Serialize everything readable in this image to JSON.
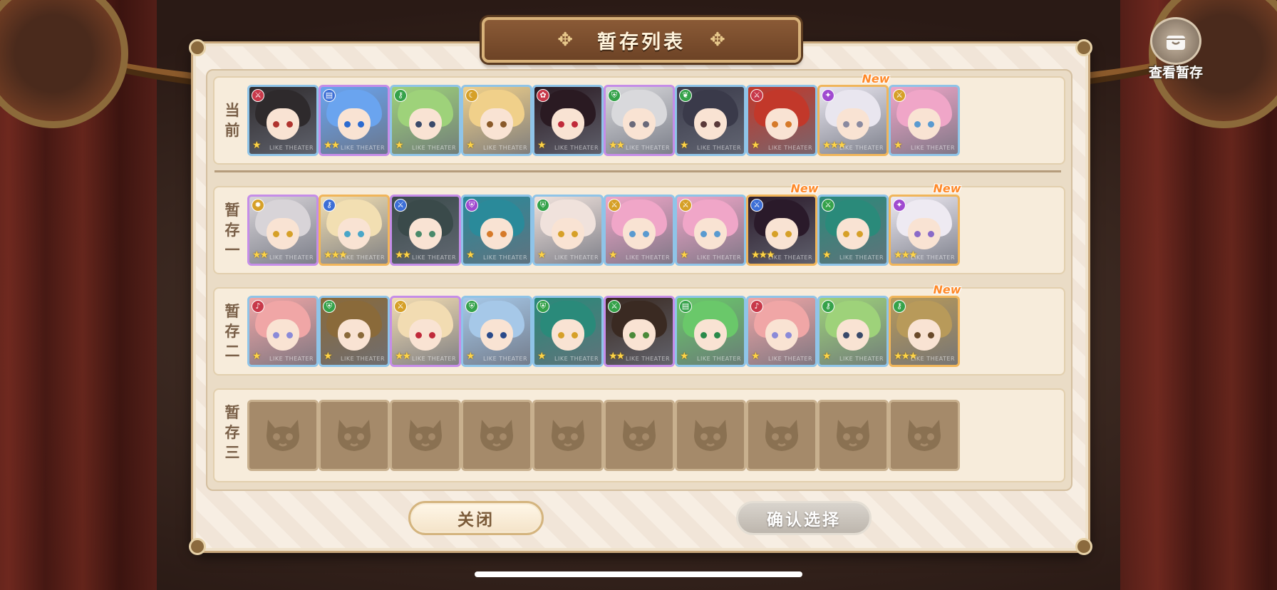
{
  "title": "暂存列表",
  "view_stash_label": "查看暂存",
  "rows": [
    {
      "label": [
        "当",
        "前"
      ],
      "cards": [
        {
          "rarity": 1,
          "element": "sword",
          "elem_color": "#c8394a",
          "hair": "#2e2a2c",
          "eyes": "#b0342f",
          "new": false
        },
        {
          "rarity": 2,
          "element": "book",
          "elem_color": "#3d6fd6",
          "hair": "#6aa4ef",
          "eyes": "#2c6bd0",
          "new": false
        },
        {
          "rarity": 1,
          "element": "key",
          "elem_color": "#35a24a",
          "hair": "#9ed27a",
          "eyes": "#3a4a6a",
          "new": false
        },
        {
          "rarity": 1,
          "element": "moon",
          "elem_color": "#d6a028",
          "hair": "#f0d08a",
          "eyes": "#8a5a2a",
          "new": false
        },
        {
          "rarity": 1,
          "element": "rose",
          "elem_color": "#c8394a",
          "hair": "#2a1a22",
          "eyes": "#c02a3a",
          "new": false
        },
        {
          "rarity": 2,
          "element": "shield",
          "elem_color": "#35a24a",
          "hair": "#d9d9dc",
          "eyes": "#6a6a7a",
          "new": false
        },
        {
          "rarity": 1,
          "element": "leaf",
          "elem_color": "#35a24a",
          "hair": "#3a3a4a",
          "eyes": "#5a3a3a",
          "new": false
        },
        {
          "rarity": 1,
          "element": "sword",
          "elem_color": "#c8394a",
          "hair": "#c2382a",
          "eyes": "#d67a2a",
          "new": false
        },
        {
          "rarity": 3,
          "element": "wand",
          "elem_color": "#a04ad0",
          "hair": "#e9e6ef",
          "eyes": "#8a8aa0",
          "new": true
        },
        {
          "rarity": 1,
          "element": "sword",
          "elem_color": "#d6a028",
          "hair": "#f0a6c8",
          "eyes": "#5a9ad0",
          "new": false
        }
      ]
    },
    {
      "label": [
        "暂",
        "存",
        "一"
      ],
      "cards": [
        {
          "rarity": 2,
          "element": "gear",
          "elem_color": "#d6a028",
          "hair": "#d8d4d8",
          "eyes": "#d6a028",
          "new": false
        },
        {
          "rarity": 3,
          "element": "key",
          "elem_color": "#3d6fd6",
          "hair": "#f2dfb2",
          "eyes": "#4aa6c8",
          "new": false
        },
        {
          "rarity": 2,
          "element": "sword",
          "elem_color": "#3d6fd6",
          "hair": "#3a4a4a",
          "eyes": "#4a8a6a",
          "new": false
        },
        {
          "rarity": 1,
          "element": "shield",
          "elem_color": "#a04ad0",
          "hair": "#2a8a9a",
          "eyes": "#d67a2a",
          "new": false
        },
        {
          "rarity": 1,
          "element": "shield",
          "elem_color": "#35a24a",
          "hair": "#f0e2dc",
          "eyes": "#d6a028",
          "new": false
        },
        {
          "rarity": 1,
          "element": "sword",
          "elem_color": "#d6a028",
          "hair": "#f0a6c8",
          "eyes": "#5a9ad0",
          "new": false
        },
        {
          "rarity": 1,
          "element": "sword",
          "elem_color": "#d6a028",
          "hair": "#f0a6c8",
          "eyes": "#5a9ad0",
          "new": false
        },
        {
          "rarity": 3,
          "element": "sword",
          "elem_color": "#3d6fd6",
          "hair": "#2a1a2a",
          "eyes": "#d6a028",
          "new": true
        },
        {
          "rarity": 1,
          "element": "sword",
          "elem_color": "#35a24a",
          "hair": "#2a8a7a",
          "eyes": "#d6a028",
          "new": false
        },
        {
          "rarity": 3,
          "element": "wand",
          "elem_color": "#a04ad0",
          "hair": "#eeeaf2",
          "eyes": "#8a6ac8",
          "new": true
        }
      ]
    },
    {
      "label": [
        "暂",
        "存",
        "二"
      ],
      "cards": [
        {
          "rarity": 1,
          "element": "note",
          "elem_color": "#c8394a",
          "hair": "#f0a6a6",
          "eyes": "#8a8ad8",
          "new": false
        },
        {
          "rarity": 1,
          "element": "shield",
          "elem_color": "#35a24a",
          "hair": "#8a6a3a",
          "eyes": "#8a6a3a",
          "new": false
        },
        {
          "rarity": 2,
          "element": "sword",
          "elem_color": "#d6a028",
          "hair": "#f2dcb2",
          "eyes": "#c02a3a",
          "new": false
        },
        {
          "rarity": 1,
          "element": "shield",
          "elem_color": "#35a24a",
          "hair": "#a6c8e8",
          "eyes": "#2a4a8a",
          "new": false
        },
        {
          "rarity": 1,
          "element": "shield",
          "elem_color": "#35a24a",
          "hair": "#2a8a7a",
          "eyes": "#d6a028",
          "new": false
        },
        {
          "rarity": 2,
          "element": "sword",
          "elem_color": "#35a24a",
          "hair": "#3a2a22",
          "eyes": "#4a8a3a",
          "new": false
        },
        {
          "rarity": 1,
          "element": "book",
          "elem_color": "#35a24a",
          "hair": "#6ac86a",
          "eyes": "#2a8a4a",
          "new": false
        },
        {
          "rarity": 1,
          "element": "note",
          "elem_color": "#c8394a",
          "hair": "#f0a6a6",
          "eyes": "#8a8ad8",
          "new": false
        },
        {
          "rarity": 1,
          "element": "key",
          "elem_color": "#35a24a",
          "hair": "#9ed27a",
          "eyes": "#3a4a6a",
          "new": false
        },
        {
          "rarity": 3,
          "element": "key",
          "elem_color": "#35a24a",
          "hair": "#b89a5a",
          "eyes": "#6a4a2a",
          "new": true
        }
      ]
    },
    {
      "label": [
        "暂",
        "存",
        "三"
      ],
      "empty_slots": 10
    }
  ],
  "card_brand": "LIKE THEATER",
  "new_label": "New",
  "buttons": {
    "close": "关闭",
    "confirm": "确认选择"
  }
}
